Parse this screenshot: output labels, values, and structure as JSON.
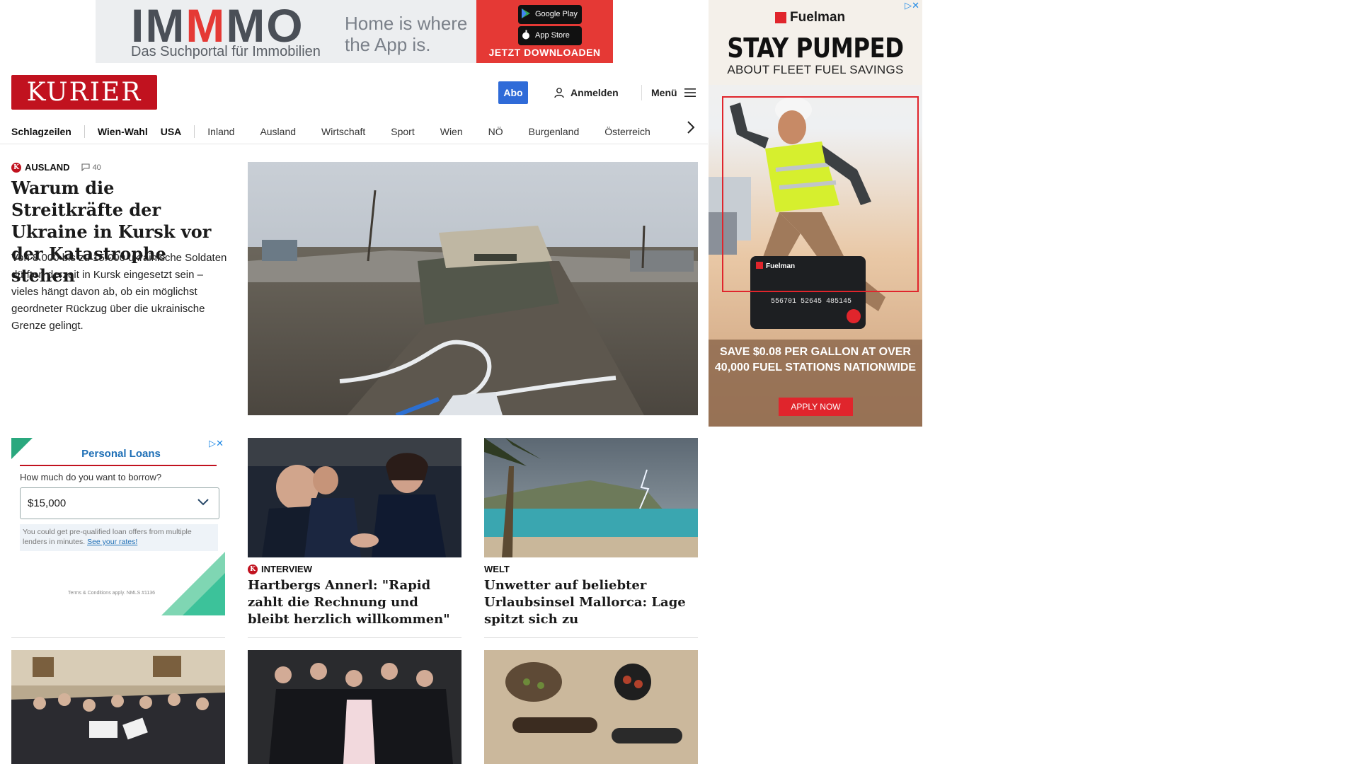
{
  "top_ad": {
    "brand_a": "IM",
    "brand_b": "M",
    "brand_c": "MO",
    "subline": "Das Suchportal für Immobilien",
    "claim": "Home is where the App is.",
    "google_play": "Google Play",
    "app_store": "App Store",
    "cta": "JETZT DOWNLOADEN"
  },
  "header": {
    "logo": "KURIER",
    "abo": "Abo",
    "login": "Anmelden",
    "menu": "Menü"
  },
  "nav": {
    "items": [
      "Schlagzeilen",
      "Wien-Wahl",
      "USA",
      "Inland",
      "Ausland",
      "Wirtschaft",
      "Sport",
      "Wien",
      "NÖ",
      "Burgenland",
      "Österreich"
    ]
  },
  "lead": {
    "kicker": "AUSLAND",
    "comments": "40",
    "title": "Warum die Streitkräfte der Ukraine in Kursk vor der Katastrophe stehen",
    "teaser": "Von 8.000 bis zu 15.000 ukrainische Soldaten dürften derzeit in Kursk eingesetzt sein – vieles hängt davon ab, ob ein möglichst geordneter Rückzug über die ukrainische Grenze gelingt."
  },
  "loans_ad": {
    "title": "Personal Loans",
    "question": "How much do you want to borrow?",
    "amount": "$15,000",
    "note": "You could get pre-qualified loan offers from multiple lenders in minutes.",
    "note_link": "See your rates!",
    "terms": "Terms & Conditions apply. NMLS #1136"
  },
  "cards": [
    {
      "kicker": "INTERVIEW",
      "title": "Hartbergs Annerl: \"Rapid zahlt die Rechnung und bleibt herzlich willkommen\""
    },
    {
      "kicker": "WELT",
      "title": "Unwetter auf beliebter Urlaubsinsel Mallorca: Lage spitzt sich zu"
    }
  ],
  "fuel_ad": {
    "brand": "Fuelman",
    "headline": "STAY PUMPED",
    "subheadline": "ABOUT FLEET FUEL SAVINGS",
    "card_number": "556701 52645 485145",
    "offer": "SAVE $0.08 PER GALLON AT OVER 40,000 FUEL STATIONS NATIONWIDE",
    "cta": "APPLY NOW"
  },
  "colors": {
    "brand_red": "#c1121f",
    "abo_blue": "#2f6bd8"
  }
}
